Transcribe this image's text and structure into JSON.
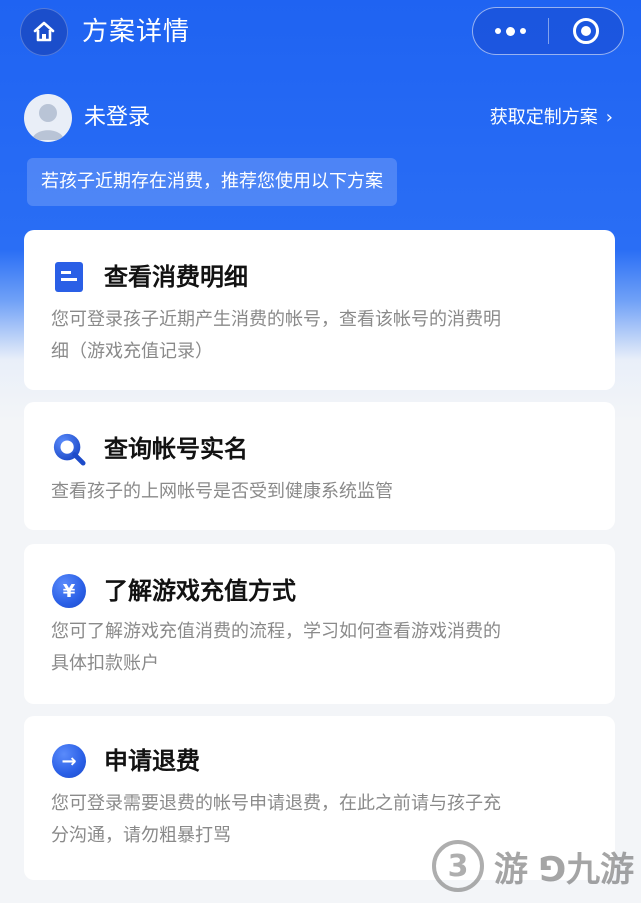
{
  "header": {
    "title": "方案详情",
    "home_icon": "home-icon",
    "more_icon": "more-dots-icon",
    "close_icon": "target-icon"
  },
  "user": {
    "name": "未登录",
    "custom_plan_link": "获取定制方案",
    "custom_plan_arrow": "›"
  },
  "notice": "若孩子近期存在消费，推荐您使用以下方案",
  "cards": [
    {
      "icon": "document-icon",
      "title": "查看消费明细",
      "desc_line1": "您可登录孩子近期产生消费的帐号，查看该帐号的消费明",
      "desc_line2": "细（游戏充值记录）"
    },
    {
      "icon": "search-icon",
      "title": "查询帐号实名",
      "desc_line1": "查看孩子的上网帐号是否受到健康系统监管",
      "desc_line2": ""
    },
    {
      "icon": "yen-icon",
      "icon_text": "¥",
      "title": "了解游戏充值方式",
      "desc_line1": "您可了解游戏充值消费的流程，学习如何查看游戏消费的",
      "desc_line2": "具体扣款账户"
    },
    {
      "icon": "arrow-right-icon",
      "icon_text": "→",
      "title": "申请退费",
      "desc_line1": "您可登录需要退费的帐号申请退费，在此之前请与孩子充",
      "desc_line2": "分沟通，请勿粗暴打骂"
    }
  ],
  "watermark": {
    "circle": "3",
    "text": "游 ⅁九游"
  },
  "colors": {
    "primary": "#1f63f2",
    "accent_icon": "#2a5fe6",
    "desc_text": "#8a8a8a"
  }
}
